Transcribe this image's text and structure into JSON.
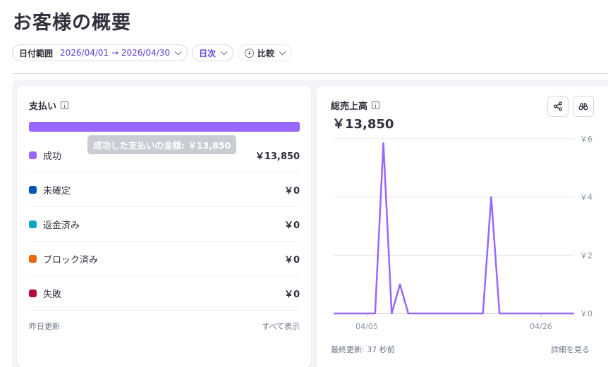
{
  "page": {
    "title": "お客様の概要"
  },
  "filters": {
    "date_range_label": "日付範囲",
    "date_range_value": "2026/04/01 → 2026/04/30",
    "interval": "日次",
    "compare": "比較"
  },
  "payments_card": {
    "title": "支払い",
    "tooltip": "成功した支払いの金額: ￥13,850",
    "rows": [
      {
        "label": "成功",
        "value": "￥13,850",
        "color": "#9966ff"
      },
      {
        "label": "未確定",
        "value": "￥0",
        "color": "#0055bc"
      },
      {
        "label": "返金済み",
        "value": "￥0",
        "color": "#0aa4c8"
      },
      {
        "label": "ブロック済み",
        "value": "￥0",
        "color": "#ed6704"
      },
      {
        "label": "失敗",
        "value": "￥0",
        "color": "#b3093c"
      }
    ],
    "footer_left": "昨日更新",
    "footer_right": "すべて表示"
  },
  "gross_volume_card": {
    "title": "総売上高",
    "value": "￥13,850",
    "share_icon": "share-icon",
    "explore_icon": "binoculars-icon",
    "footer_left": "最終更新: 37 秒前",
    "footer_right": "詳細を見る"
  },
  "chart_data": {
    "type": "line",
    "series": [
      {
        "values": [
          0,
          0,
          0,
          0,
          0,
          0,
          0,
          0,
          0,
          0,
          0,
          0,
          0,
          0,
          0,
          0,
          0,
          0,
          0,
          0,
          0,
          0,
          0,
          0,
          0,
          0,
          0,
          0,
          0,
          0
        ]
      }
    ],
    "y_tick_labels": [
      "￥6",
      "￥4",
      "￥2",
      "￥0"
    ],
    "x_tick_labels": [
      "04/05",
      "04/26"
    ],
    "points": [
      {
        "x": "04/01",
        "y": 0
      },
      {
        "x": "04/06",
        "y": 0
      },
      {
        "x": "04/07",
        "y": 5.85
      },
      {
        "x": "04/08",
        "y": 0
      },
      {
        "x": "04/09",
        "y": 1
      },
      {
        "x": "04/10",
        "y": 0
      },
      {
        "x": "04/19",
        "y": 0
      },
      {
        "x": "04/20",
        "y": 4
      },
      {
        "x": "04/21",
        "y": 0
      },
      {
        "x": "04/30",
        "y": 0
      }
    ],
    "ylim": [
      0,
      6
    ],
    "color": "#9966ff",
    "grid": true
  }
}
